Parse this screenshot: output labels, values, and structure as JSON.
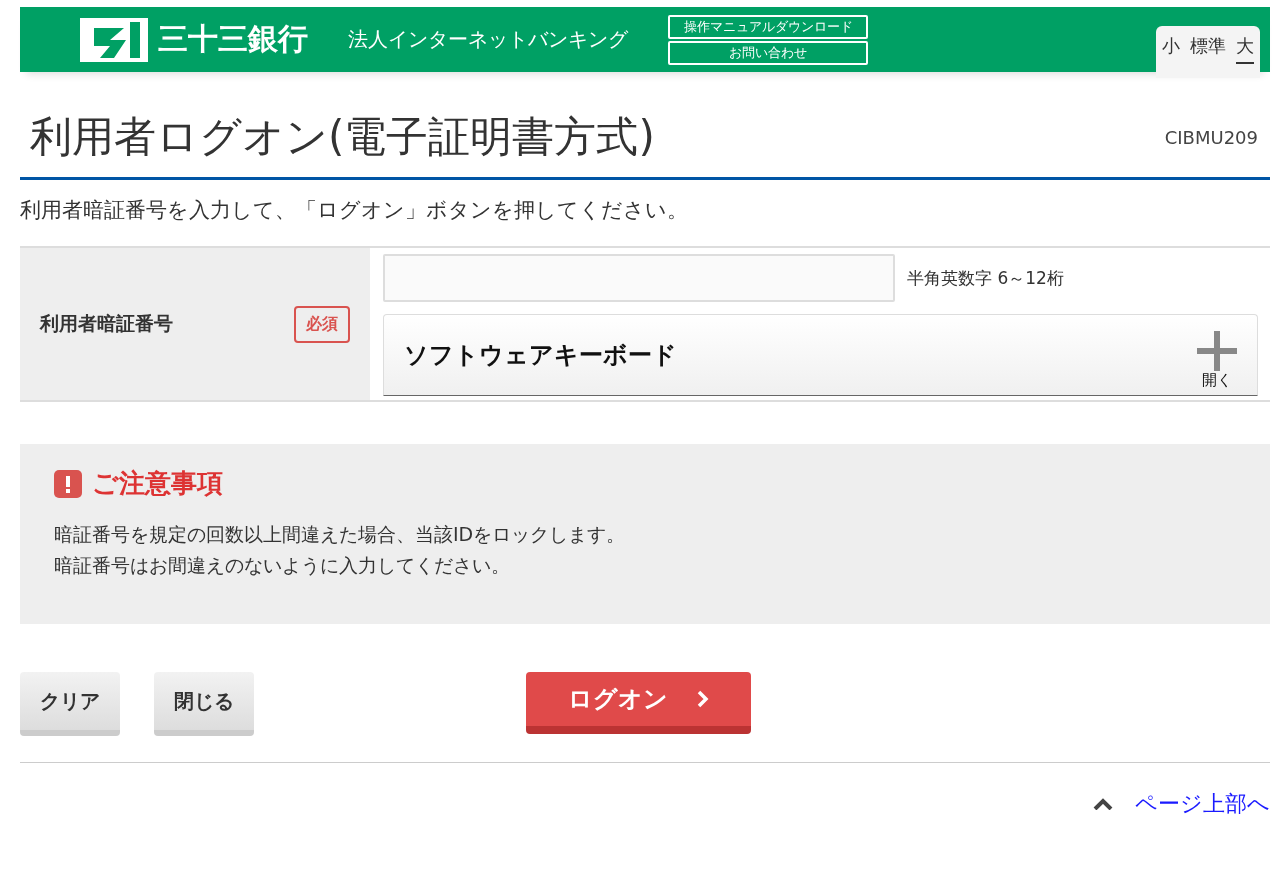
{
  "header": {
    "bank_name": "三十三銀行",
    "service_name": "法人インターネットバンキング",
    "links": [
      "操作マニュアルダウンロード",
      "お問い合わせ"
    ],
    "font_sizes": [
      {
        "label": "小",
        "selected": false
      },
      {
        "label": "標準",
        "selected": false
      },
      {
        "label": "大",
        "selected": true
      }
    ]
  },
  "page": {
    "title": "利用者ログオン(電子証明書方式)",
    "screen_id": "CIBMU209",
    "instruction": "利用者暗証番号を入力して、「ログオン」ボタンを押してください。"
  },
  "form": {
    "label": "利用者暗証番号",
    "required_badge": "必須",
    "hint": "半角英数字 6～12桁",
    "keyboard": {
      "title": "ソフトウェアキーボード",
      "toggle_label": "開く",
      "expanded": false
    }
  },
  "notice": {
    "title": "ご注意事項",
    "lines": [
      "暗証番号を規定の回数以上間違えた場合、当該IDをロックします。",
      "暗証番号はお間違えのないように入力してください。"
    ]
  },
  "buttons": {
    "clear": "クリア",
    "close": "閉じる",
    "logon": "ログオン"
  },
  "page_top_link": "ページ上部へ"
}
